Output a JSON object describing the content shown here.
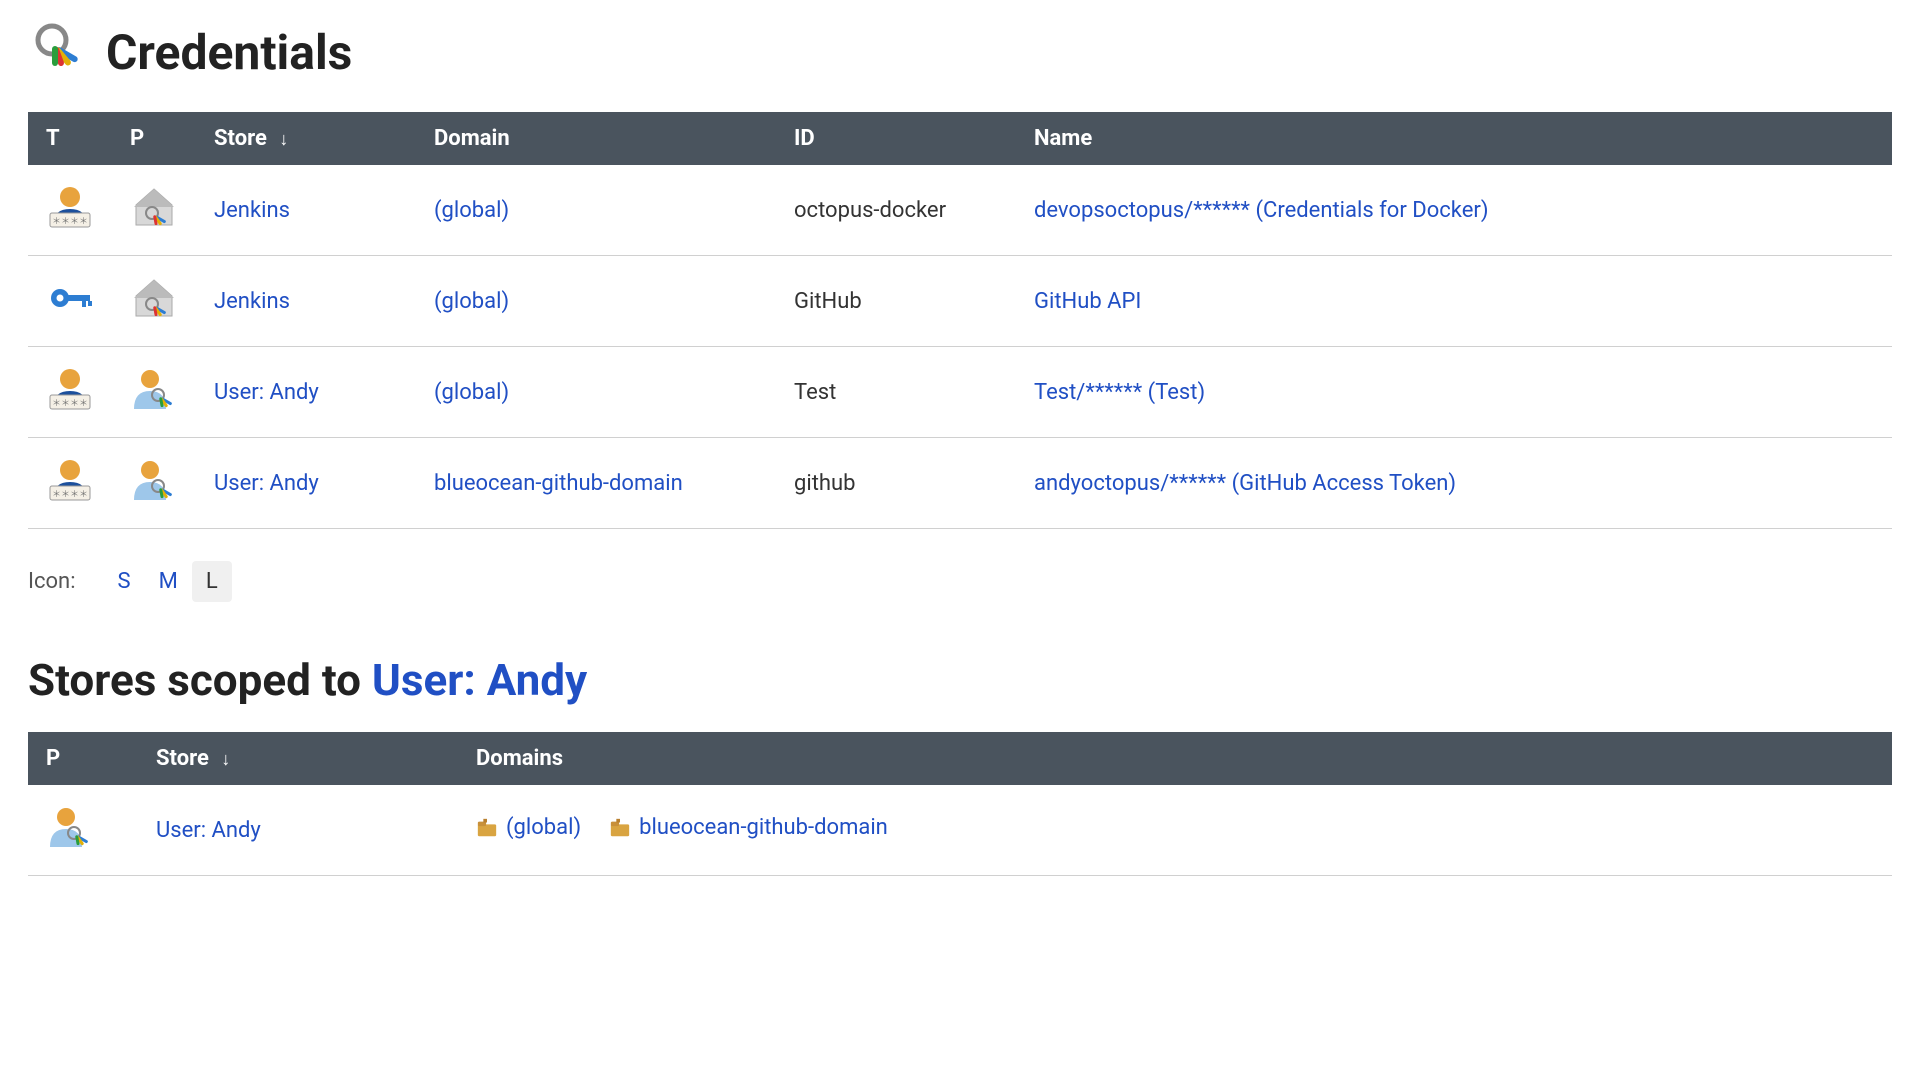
{
  "page": {
    "title": "Credentials"
  },
  "columns": {
    "t": "T",
    "p": "P",
    "store": "Store",
    "domain": "Domain",
    "id": "ID",
    "name": "Name"
  },
  "rows": [
    {
      "t_icon": "credentials-userpass-icon",
      "p_icon": "store-system-icon",
      "store": "Jenkins",
      "domain": "(global)",
      "id": "octopus-docker",
      "name": "devopsoctopus/****** (Credentials for Docker)"
    },
    {
      "t_icon": "credentials-key-icon",
      "p_icon": "store-system-icon",
      "store": "Jenkins",
      "domain": "(global)",
      "id": "GitHub",
      "name": "GitHub API"
    },
    {
      "t_icon": "credentials-userpass-icon",
      "p_icon": "store-user-icon",
      "store": "User: Andy",
      "domain": "(global)",
      "id": "Test",
      "name": "Test/****** (Test)"
    },
    {
      "t_icon": "credentials-userpass-icon",
      "p_icon": "store-user-icon",
      "store": "User: Andy",
      "domain": "blueocean-github-domain",
      "id": "github",
      "name": "andyoctopus/****** (GitHub Access Token)"
    }
  ],
  "icon_size": {
    "label": "Icon:",
    "options": [
      "S",
      "M",
      "L"
    ],
    "active": "L"
  },
  "scoped": {
    "title_prefix": "Stores scoped to ",
    "user": "User: Andy",
    "columns": {
      "p": "P",
      "store": "Store",
      "domains": "Domains"
    },
    "rows": [
      {
        "p_icon": "store-user-icon",
        "store": "User: Andy",
        "domains": [
          "(global)",
          "blueocean-github-domain"
        ]
      }
    ]
  }
}
